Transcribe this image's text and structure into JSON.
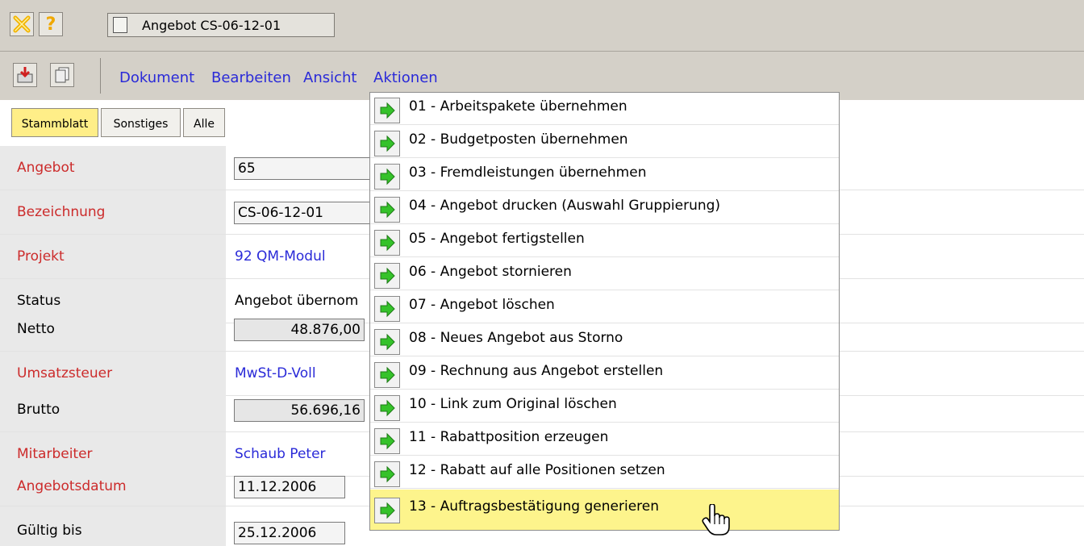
{
  "window": {
    "document_tab": "Angebot CS-06-12-01"
  },
  "toolbar": {
    "icons": [
      "close-icon",
      "help-icon",
      "document-icon",
      "save-icon",
      "copy-icon"
    ]
  },
  "menubar": {
    "items": [
      "Dokument",
      "Bearbeiten",
      "Ansicht",
      "Aktionen"
    ]
  },
  "tabs": [
    {
      "label": "Stammblatt",
      "active": true
    },
    {
      "label": "Sonstiges",
      "active": false
    },
    {
      "label": "Alle",
      "active": false
    }
  ],
  "form": {
    "angebot": {
      "label": "Angebot",
      "value": "65"
    },
    "bezeichnung": {
      "label": "Bezeichnung",
      "value": "CS-06-12-01"
    },
    "projekt": {
      "label": "Projekt",
      "value": "92 QM-Modul"
    },
    "status": {
      "label": "Status",
      "value": "Angebot übernom"
    },
    "netto": {
      "label": "Netto",
      "value": "48.876,00"
    },
    "umsatzsteuer": {
      "label": "Umsatzsteuer",
      "value": "MwSt-D-Voll"
    },
    "brutto": {
      "label": "Brutto",
      "value": "56.696,16"
    },
    "mitarbeiter": {
      "label": "Mitarbeiter",
      "value": "Schaub Peter"
    },
    "angebotsdatum": {
      "label": "Angebotsdatum",
      "value": "11.12.2006"
    },
    "gueltig_bis": {
      "label": "Gültig bis",
      "value": "25.12.2006"
    }
  },
  "actions_menu": {
    "highlighted_index": 12,
    "items": [
      "01 - Arbeitspakete übernehmen",
      "02 - Budgetposten übernehmen",
      "03 - Fremdleistungen übernehmen",
      "04 - Angebot drucken (Auswahl Gruppierung)",
      "05 - Angebot fertigstellen",
      "06 - Angebot stornieren",
      "07 - Angebot löschen",
      "08 - Neues Angebot aus Storno",
      "09 - Rechnung aus Angebot erstellen",
      "10 - Link zum Original löschen",
      "11 - Rabattposition erzeugen",
      "12 - Rabatt auf alle Positionen setzen",
      "13 - Auftragsbestätigung generieren"
    ]
  },
  "colors": {
    "chrome": "#d4d0c8",
    "menu_link": "#2a2ad8",
    "label_required": "#cc2b2b",
    "highlight": "#fdf48c",
    "active_tab": "#ffee88",
    "arrow_green": "#35c22a"
  }
}
